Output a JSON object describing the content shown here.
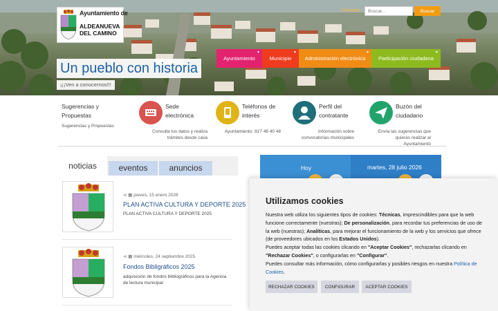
{
  "header": {
    "logo_line1": "Ayuntamiento de",
    "logo_line2": "ALDEANUEVA DEL CAMINO",
    "contact_label": "Contacto",
    "search_placeholder": "Buscar...",
    "search_button": "Buscar",
    "tagline_title": "Un pueblo con historia",
    "tagline_subtitle": "¡¡¡Ven a conocernos!!!"
  },
  "nav": {
    "items": [
      {
        "label": "Ayuntamiento",
        "color": "#e2236f"
      },
      {
        "label": "Municipio",
        "color": "#ef3b1e"
      },
      {
        "label": "Administración electrónica",
        "color": "#f08c16"
      },
      {
        "label": "Participación ciudadana",
        "color": "#8dbb1f"
      }
    ]
  },
  "quick_links": [
    {
      "title": "Sugerencias y Propuestas",
      "desc": "Sugerencias y Propuestas",
      "icon": "none",
      "color": ""
    },
    {
      "title": "Sede electrónica",
      "desc": "Consulta tus datos y realiza trámites desde casa",
      "icon": "keyboard-icon",
      "color": "#d9534f"
    },
    {
      "title": "Teléfonos de interés",
      "desc": "Ayuntamiento: 927 48 40 48",
      "icon": "phone-icon",
      "color": "#e0b316"
    },
    {
      "title": "Perfil del contratante",
      "desc": "Información sobre convocatorias municipales",
      "icon": "user-icon",
      "color": "#1f6f7a"
    },
    {
      "title": "Buzón del ciudadano",
      "desc": "Envía las sugerencias que quieras realizar al Ayuntamiento",
      "icon": "send-icon",
      "color": "#22a36b"
    }
  ],
  "tabs": [
    {
      "label": "noticias"
    },
    {
      "label": "eventos"
    },
    {
      "label": "anuncios"
    }
  ],
  "news": [
    {
      "date": "jueves, 15 enero 2026",
      "title": "PLAN ACTIVA CULTURA Y DEPORTE 2025",
      "desc": "PLAN ACTIVA CULTURA Y DEPORTE 2025"
    },
    {
      "date": "miércoles, 24 septiembre 2025",
      "title": "Fondos Bibligráficos 2025",
      "desc": "adquisición de fondos bibliográficos para la Agencia de lectura municipal"
    }
  ],
  "weather": {
    "today_label": "Hoy",
    "tomorrow_label": "martes, 28 julio 2026"
  },
  "cookies": {
    "title": "Utilizamos cookies",
    "p1_a": "Nuestra web utiliza los siguientes tipos de cookies: ",
    "p1_b": "Técnicas",
    "p1_c": ", imprescindibles para que la web funcione correctamente (nuestras); ",
    "p1_d": "De personalización",
    "p1_e": ", para recordar tus preferencias de uso de la web (nuestras); ",
    "p1_f": "Analíticas",
    "p1_g": ", para mejorar el funcionamiento de la web y los servicios que ofrece (de proveedores ubicados en los ",
    "p1_h": "Estados Unidos",
    "p1_i": ").",
    "p2_a": "Puedes aceptar todas las cookies clicando en ",
    "p2_b": "\"Aceptar Cookies\"",
    "p2_c": ", rechazarlas clicando en ",
    "p2_d": "\"Rechazar Cookies\"",
    "p2_e": ", o configurarlas en ",
    "p2_f": "\"Configurar\"",
    "p2_g": ".",
    "p3_a": "Puedes consultar más información, cómo configurarlas y posibles riesgos en nuestra ",
    "p3_link": "Política de Cookies",
    "p3_b": ".",
    "btn_reject": "RECHAZAR COOKIES",
    "btn_config": "CONFIGURAR",
    "btn_accept": "ACEPTAR COOKIES"
  }
}
